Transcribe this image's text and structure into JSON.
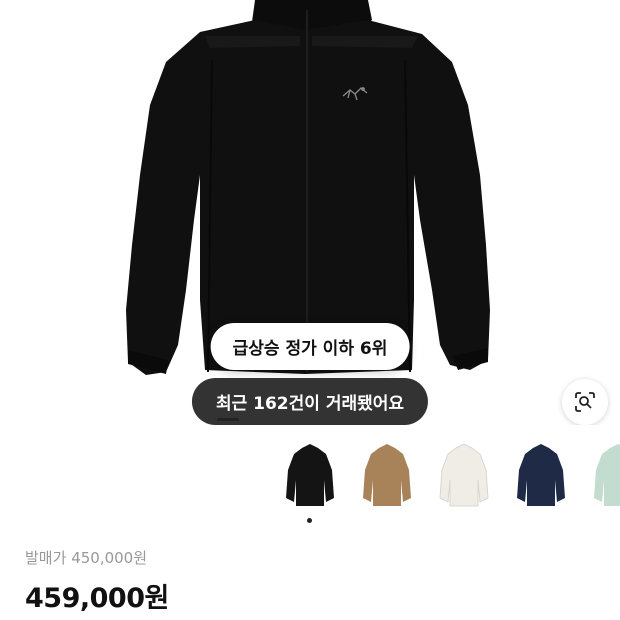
{
  "product": {
    "image_alt": "black hooded jacket",
    "logo": "bird-logo-icon"
  },
  "badges": {
    "rank": "급상승 정가 이하 6위",
    "recent_trades": "최근 162건이 거래됐어요"
  },
  "lens_button": {
    "icon": "lens-search-icon"
  },
  "color_thumbnails": [
    {
      "color": "#141414",
      "name": "black"
    },
    {
      "color": "#a88258",
      "name": "tan"
    },
    {
      "color": "#efede6",
      "name": "white"
    },
    {
      "color": "#1f2a47",
      "name": "navy"
    },
    {
      "color": "#c3dcd0",
      "name": "mint"
    }
  ],
  "price": {
    "retail_label": "발매가",
    "retail_value": "450,000원",
    "current": "459,000원"
  }
}
